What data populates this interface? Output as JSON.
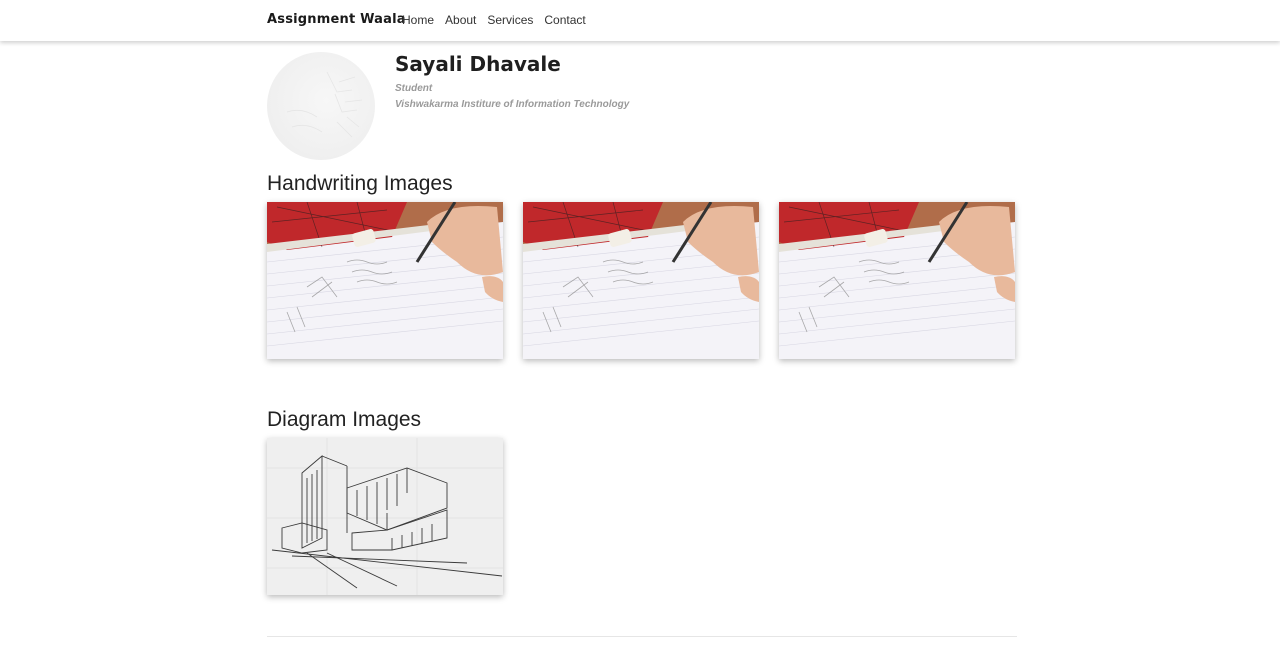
{
  "nav": {
    "brand": "Assignment Waala",
    "links": [
      "Home",
      "About",
      "Services",
      "Contact"
    ]
  },
  "profile": {
    "name": "Sayali Dhavale",
    "role": "Student",
    "institute": "Vishwakarma Institure of Information Technology"
  },
  "sections": {
    "handwriting_title": "Handwriting Images",
    "diagram_title": "Diagram Images"
  },
  "colors": {
    "pencil_case": "#c0282b",
    "paper": "#f4f3f8",
    "desk": "#b06d4a"
  }
}
